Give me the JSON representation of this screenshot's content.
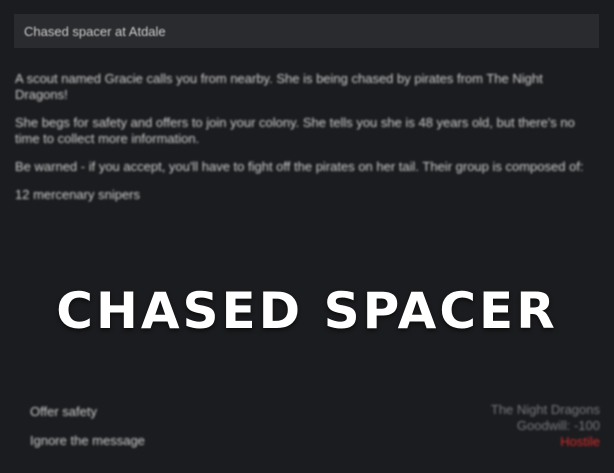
{
  "dialog": {
    "title": "Chased spacer at Atdale",
    "paragraphs": [
      "A scout named Gracie calls you from nearby. She is being chased by pirates from The Night Dragons!",
      "She begs for safety and offers to join your colony. She tells you she is 48 years old, but there's no time to collect more information.",
      "Be warned - if you accept, you'll have to fight off the pirates on her tail. Their group is composed of:",
      "12 mercenary snipers"
    ],
    "options": [
      "Offer safety",
      "Ignore the message"
    ],
    "faction": {
      "name": "The Night Dragons",
      "goodwill": "Goodwill: -100",
      "status": "Hostile"
    }
  },
  "banner": {
    "text": "CHASED SPACER"
  },
  "colors": {
    "hostile": "#d42b2b",
    "panel": "#2a2b2e",
    "background": "#1b1c1f"
  }
}
